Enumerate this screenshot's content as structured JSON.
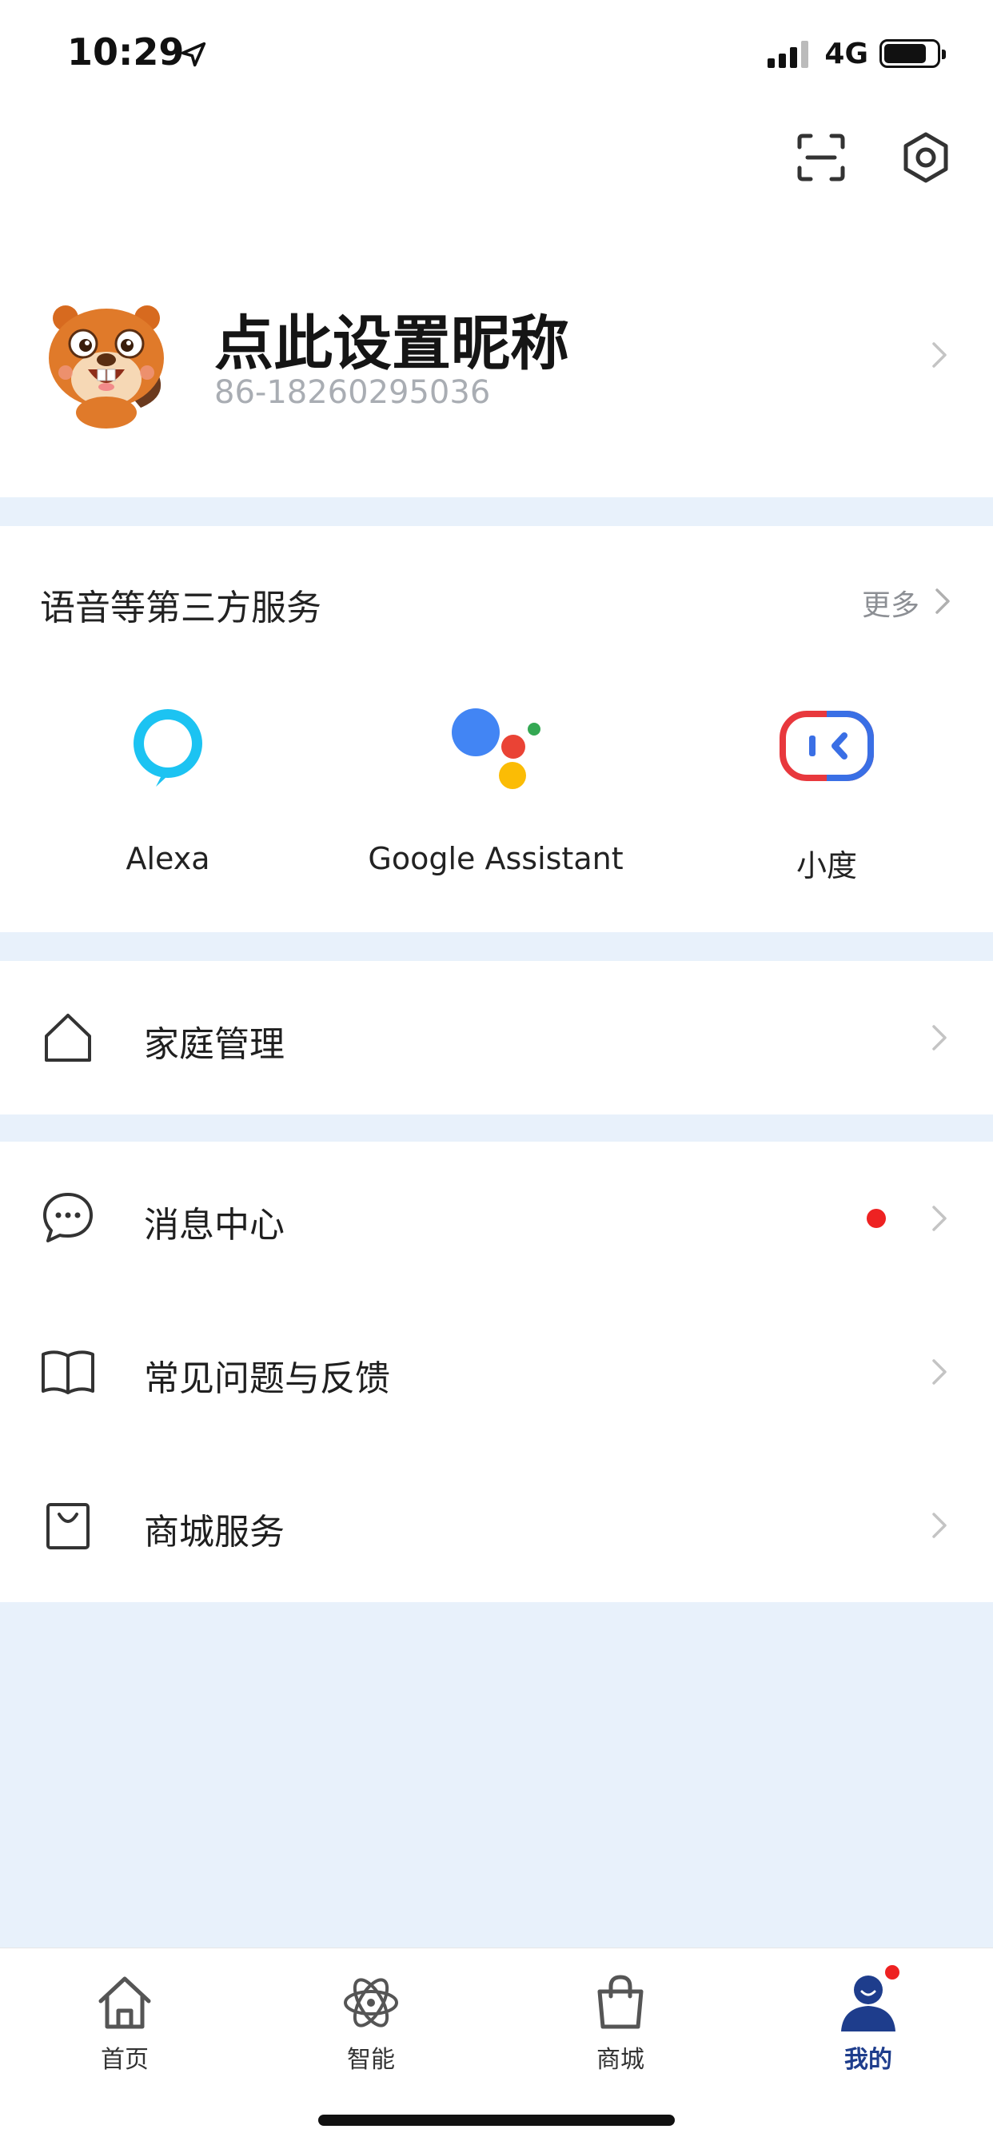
{
  "status_bar": {
    "time": "10:29",
    "network": "4G",
    "icons": [
      "location-arrow-icon",
      "signal-icon",
      "battery-icon"
    ]
  },
  "top_bar": {
    "icons": [
      "scan-icon",
      "settings-icon"
    ]
  },
  "profile": {
    "nickname": "点此设置昵称",
    "phone": "86-18260295036"
  },
  "services": {
    "title": "语音等第三方服务",
    "more_label": "更多",
    "items": [
      {
        "label": "Alexa",
        "icon": "alexa-icon"
      },
      {
        "label": "Google Assistant",
        "icon": "google-assistant-icon"
      },
      {
        "label": "小度",
        "icon": "xiaodu-icon"
      }
    ]
  },
  "menu": {
    "family": {
      "label": "家庭管理",
      "icon": "house-icon"
    },
    "messages": {
      "label": "消息中心",
      "icon": "chat-bubble-icon",
      "unread": true
    },
    "faq": {
      "label": "常见问题与反馈",
      "icon": "book-icon"
    },
    "shop": {
      "label": "商城服务",
      "icon": "shopping-bag-icon"
    }
  },
  "tab_bar": {
    "tabs": [
      {
        "label": "首页",
        "icon": "home-tab-icon"
      },
      {
        "label": "智能",
        "icon": "smart-atom-icon"
      },
      {
        "label": "商城",
        "icon": "shop-bag-tab-icon"
      },
      {
        "label": "我的",
        "icon": "profile-tab-icon",
        "active": true,
        "badge": true
      }
    ]
  },
  "colors": {
    "background": "#E8F1FB",
    "accent": "#1E3D8C",
    "badge": "#EE2222",
    "secondary_text": "#A9ADB3"
  }
}
